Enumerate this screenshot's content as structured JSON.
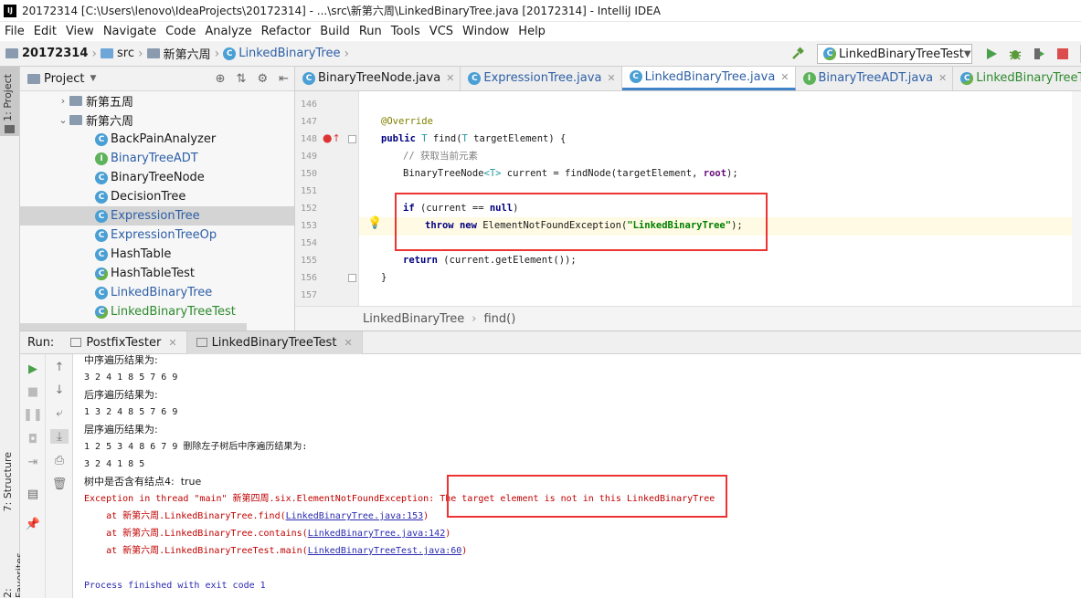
{
  "window": {
    "title": "20172314 [C:\\Users\\lenovo\\IdeaProjects\\20172314] - ...\\src\\新第六周\\LinkedBinaryTree.java [20172314] - IntelliJ IDEA",
    "app_icon": "IJ"
  },
  "menu": [
    "File",
    "Edit",
    "View",
    "Navigate",
    "Code",
    "Analyze",
    "Refactor",
    "Build",
    "Run",
    "Tools",
    "VCS",
    "Window",
    "Help"
  ],
  "navbar": {
    "project": "20172314",
    "src": "src",
    "folder": "新第六周",
    "file": "LinkedBinaryTree",
    "run_config": "LinkedBinaryTreeTest"
  },
  "left_strip": {
    "project": "1: Project",
    "structure": "7: Structure",
    "favorites": "2: Favorites"
  },
  "project_panel": {
    "title": "Project",
    "tree": [
      {
        "label": "新第五周",
        "kind": "folder",
        "expanded": false
      },
      {
        "label": "新第六周",
        "kind": "folder",
        "expanded": true
      },
      {
        "label": "BackPainAnalyzer",
        "kind": "class"
      },
      {
        "label": "BinaryTreeADT",
        "kind": "interface"
      },
      {
        "label": "BinaryTreeNode",
        "kind": "class"
      },
      {
        "label": "DecisionTree",
        "kind": "class"
      },
      {
        "label": "ExpressionTree",
        "kind": "class",
        "selected": true
      },
      {
        "label": "ExpressionTreeOp",
        "kind": "class"
      },
      {
        "label": "HashTable",
        "kind": "class"
      },
      {
        "label": "HashTableTest",
        "kind": "test"
      },
      {
        "label": "LinkedBinaryTree",
        "kind": "class"
      },
      {
        "label": "LinkedBinaryTreeTest",
        "kind": "test"
      }
    ]
  },
  "editor_tabs": [
    {
      "label": "BinaryTreeNode.java",
      "kind": "class"
    },
    {
      "label": "ExpressionTree.java",
      "kind": "class"
    },
    {
      "label": "LinkedBinaryTree.java",
      "kind": "class",
      "active": true
    },
    {
      "label": "BinaryTreeADT.java",
      "kind": "interface"
    },
    {
      "label": "LinkedBinaryTreeTest.java",
      "kind": "test"
    }
  ],
  "code": {
    "line_numbers": [
      "146",
      "147",
      "148",
      "149",
      "150",
      "151",
      "152",
      "153",
      "154",
      "155",
      "156",
      "157"
    ],
    "annotation": "@Override",
    "sig_kw": "public",
    "sig_type": "T",
    "sig_name": " find(",
    "sig_ptype": "T",
    "sig_rest": " targetElement) {",
    "comment": "// 获取当前元素",
    "l150_a": "BinaryTreeNode",
    "l150_gen": "<T>",
    "l150_b": " current = findNode(targetElement, ",
    "l150_root": "root",
    "l150_c": ");",
    "l152_kw": "if",
    "l152_a": " (current == ",
    "l152_null": "null",
    "l152_b": ")",
    "l153_kw1": "throw",
    "l153_kw2": "new",
    "l153_a": " ElementNotFoundException(",
    "l153_str": "\"LinkedBinaryTree\"",
    "l153_b": ");",
    "l155_kw": "return",
    "l155_a": " (current.getElement());",
    "l156": "}"
  },
  "editor_breadcrumb": {
    "cls": "LinkedBinaryTree",
    "method": "find()"
  },
  "run": {
    "label": "Run:",
    "tabs": [
      "PostfixTester",
      "LinkedBinaryTreeTest"
    ]
  },
  "console": {
    "l1": "中序遍历结果为:",
    "l2": "3 2 4 1 8 5 7 6 9",
    "l3": "后序遍历结果为:",
    "l4": "1 3 2 4 8 5 7 6 9",
    "l5": "层序遍历结果为:",
    "l6": "1 2 5 3 4 8 6 7 9 删除左子树后中序遍历结果为:",
    "l7": "3 2 4 1 8 5",
    "l8": "树中是否含有结点4:  true",
    "l9a": "Exception in thread \"main\" 新第四周.six.ElementNotFoundException: ",
    "l9b": "The target element is not in this LinkedBinaryTree",
    "st1a": "    at 新第六周.LinkedBinaryTree.find(",
    "st1b": "LinkedBinaryTree.java:153",
    "st1c": ")",
    "st2a": "    at 新第六周.LinkedBinaryTree.contains(",
    "st2b": "LinkedBinaryTree.java:142",
    "st2c": ")",
    "st3a": "    at 新第六周.LinkedBinaryTreeTest.main(",
    "st3b": "LinkedBinaryTreeTest.java:60",
    "st3c": ")",
    "exit": "Process finished with exit code 1"
  },
  "colors": {
    "highlight_box": "#ee3333",
    "error_text": "#c00000",
    "keyword": "#000080",
    "string": "#008000"
  }
}
